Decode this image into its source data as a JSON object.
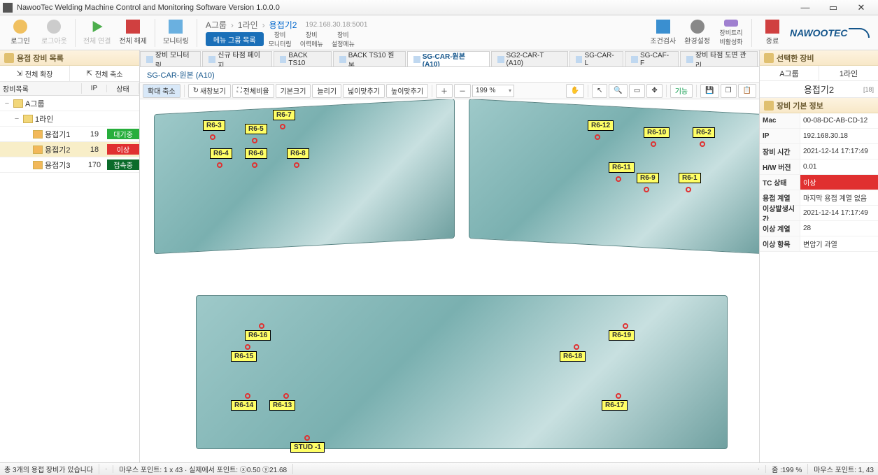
{
  "window": {
    "title": "NawooTec Welding Machine Control and Monitoring Software Version 1.0.0.0"
  },
  "ribbon": {
    "login": "로그인",
    "logout": "로그아웃",
    "conn_all": "전체 연결",
    "disc_all": "전체 해제",
    "monitoring": "모니터링",
    "menu_group": "메뉴 그룹 목록",
    "equip_mon": "장비\n모니터링",
    "equip_hist": "장비\n이력메뉴",
    "equip_set": "장비\n설정메뉴",
    "cond_check": "조건검사",
    "env": "환경설정",
    "deactivate": "장비트리\n비활성화",
    "close": "종료"
  },
  "breadcrumb": {
    "g": "A그룹",
    "l": "1라인",
    "m": "용접기2",
    "ip": "192.168.30.18:5001"
  },
  "left": {
    "title": "용접 장비 목록",
    "expand": "전체 확장",
    "collapse": "전체 축소",
    "cols": {
      "name": "장비목록",
      "ip": "IP",
      "state": "상태"
    },
    "nodes": {
      "group": "A그룹",
      "line": "1라인",
      "items": [
        {
          "name": "용접기1",
          "ip": "19",
          "state": "대기중",
          "cls": "green"
        },
        {
          "name": "용접기2",
          "ip": "18",
          "state": "이상",
          "cls": "red",
          "sel": true
        },
        {
          "name": "용접기3",
          "ip": "170",
          "state": "접속중",
          "cls": "dgreen"
        }
      ]
    }
  },
  "tabs": [
    {
      "label": "장비 모니터링"
    },
    {
      "label": "신규 타점 페이지"
    },
    {
      "label": "BACK TS10"
    },
    {
      "label": "BACK TS10 원본"
    },
    {
      "label": "SG-CAR-원본 (A10)",
      "active": true
    },
    {
      "label": "SG2-CAR-T (A10)"
    },
    {
      "label": "SG-CAR-L"
    },
    {
      "label": "SG-CAF-F"
    },
    {
      "label": "장비 타점 도면 관리"
    }
  ],
  "subhdr": "SG-CAR-원본 (A10)",
  "toolbar": {
    "shrink": "확대 축소",
    "refresh": "새창보기",
    "fit_ratio": "전체비율",
    "orig_size": "기본크기",
    "enlarge": "늘리기",
    "fit_w": "넓이맞추기",
    "fit_h": "높이맞추기",
    "zoom": "199 %",
    "func": "기능"
  },
  "markers_top_left": [
    "R6-3",
    "R6-7",
    "R6-5",
    "R6-4",
    "R6-6",
    "R6-8"
  ],
  "markers_top_right": [
    "R6-12",
    "R6-10",
    "R6-2",
    "R6-11",
    "R6-9",
    "R6-1"
  ],
  "markers_bottom": [
    "R6-16",
    "R6-15",
    "R6-14",
    "R6-13",
    "R6-19",
    "R6-18",
    "R6-17",
    "STUD -1"
  ],
  "right": {
    "title": "선택한 장비",
    "group": "A그룹",
    "line": "1라인",
    "equip": "용접기2",
    "badge": "[18]",
    "info_title": "장비 기본 정보",
    "rows": [
      {
        "k": "Mac",
        "v": "00-08-DC-AB-CD-12"
      },
      {
        "k": "IP",
        "v": "192.168.30.18"
      },
      {
        "k": "장비 시간",
        "v": "2021-12-14  17:17:49"
      },
      {
        "k": "H/W 버전",
        "v": "0.01"
      },
      {
        "k": "TC 상태",
        "v": "이상",
        "red": true
      },
      {
        "k": "용접 계열",
        "v": "마지막 용접 계열 없음"
      },
      {
        "k": "이상발생시간",
        "v": "2021-12-14  17:17:49"
      },
      {
        "k": "이상 계열",
        "v": "28"
      },
      {
        "k": "이상 항목",
        "v": "변압기 과열"
      }
    ]
  },
  "status": {
    "left": "총 3개의 용접 장비가 있습니다",
    "mouse": "마우스 포인트: 1 x 43 · 실제에서 포인트: ⓧ0.50 ⓨ21.68",
    "zoom": "줌 :199 %",
    "mouse2": "마우스 포인트: 1, 43"
  },
  "logo": "NAWOOTEC"
}
